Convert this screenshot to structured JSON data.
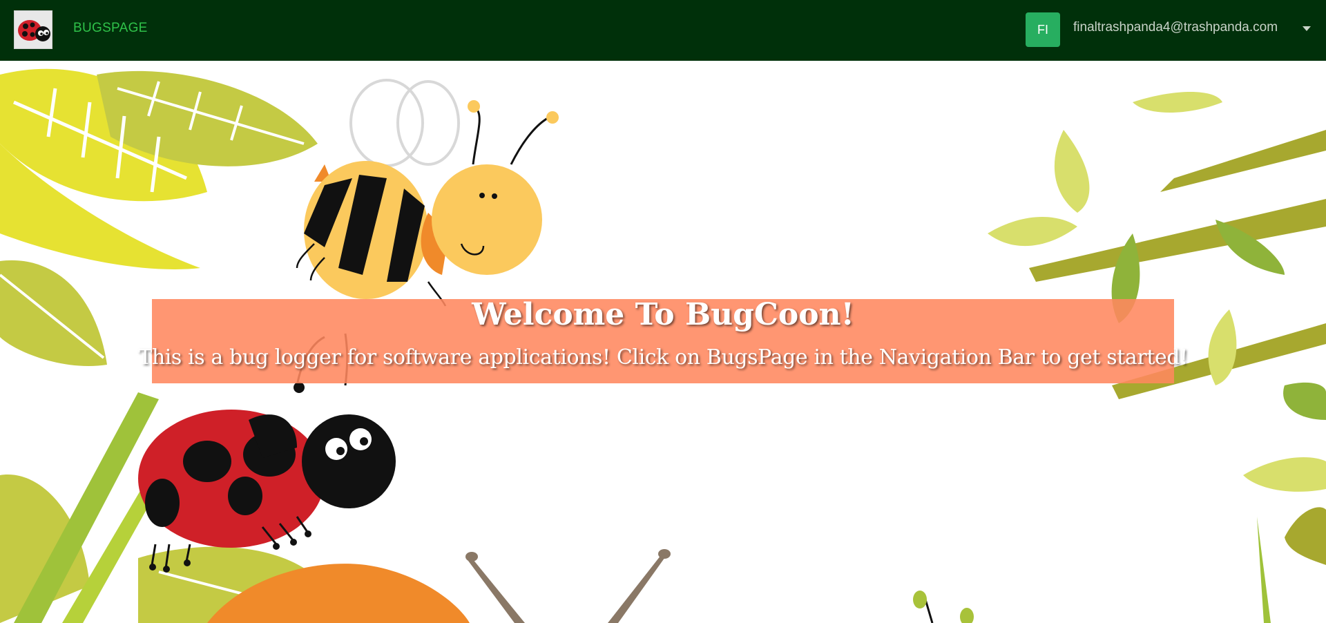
{
  "navbar": {
    "brand": "BUGSPAGE",
    "logo_icon": "ladybug-logo-icon",
    "user_initials": "FI",
    "user_email": "finaltrashpanda4@trashpanda.com",
    "menu_icon": "caret-down-icon"
  },
  "hero": {
    "title": "Welcome To BugCoon!",
    "subtitle": "This is a bug logger for software applications! Click on BugsPage in the Navigation Bar to get started!",
    "background_illustrations": [
      "bee-illustration",
      "ladybug-illustration",
      "snail-illustration",
      "leaves-illustration"
    ]
  },
  "colors": {
    "navbar_bg": "#00300a",
    "brand": "#2fc24a",
    "avatar_bg": "#27ae60",
    "banner_bg": "#ff875f"
  }
}
